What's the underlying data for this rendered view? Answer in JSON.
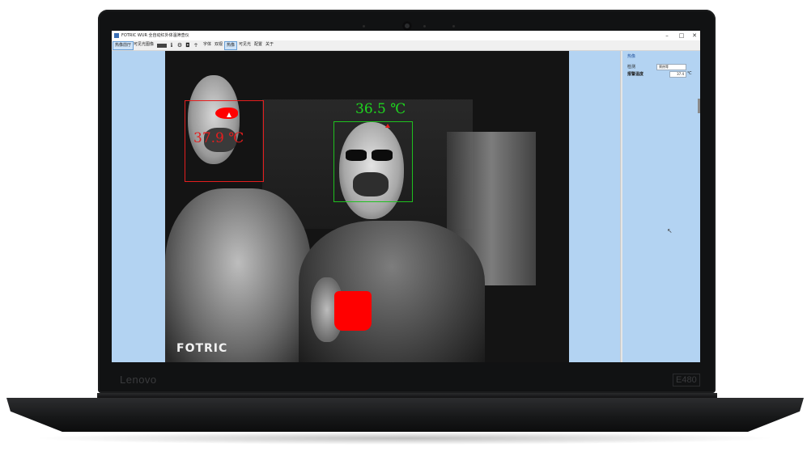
{
  "window": {
    "title": "FOTRIC WUR 全自动红外体温筛查仪",
    "controls": {
      "minimize": "–",
      "maximize": "□",
      "close": "✕"
    }
  },
  "toolbar": {
    "tabs": [
      "热像前厅",
      "可见光图像"
    ],
    "menu": [
      "字体",
      "双视",
      "热像",
      "可见光",
      "配置",
      "关于"
    ],
    "icons": [
      "image-icon",
      "info-icon",
      "settings-icon",
      "camera-icon",
      "person-icon"
    ]
  },
  "video": {
    "brand": "FOTRIC",
    "readings": [
      {
        "label": "37.9 ℃",
        "color": "#e41e1e"
      },
      {
        "label": "36.5 ℃",
        "color": "#1fd61f"
      }
    ]
  },
  "panel": {
    "title": "热像",
    "mode_label": "检测",
    "mode_value": "筛热等",
    "alarm_label": "报警温度",
    "alarm_value": "37.4",
    "alarm_unit": "℃"
  },
  "laptop": {
    "brand": "Lenovo",
    "model": "E480"
  },
  "colors": {
    "panel_bg": "#b3d3f2",
    "alarm_red": "#e41e1e",
    "normal_green": "#1fd61f"
  }
}
